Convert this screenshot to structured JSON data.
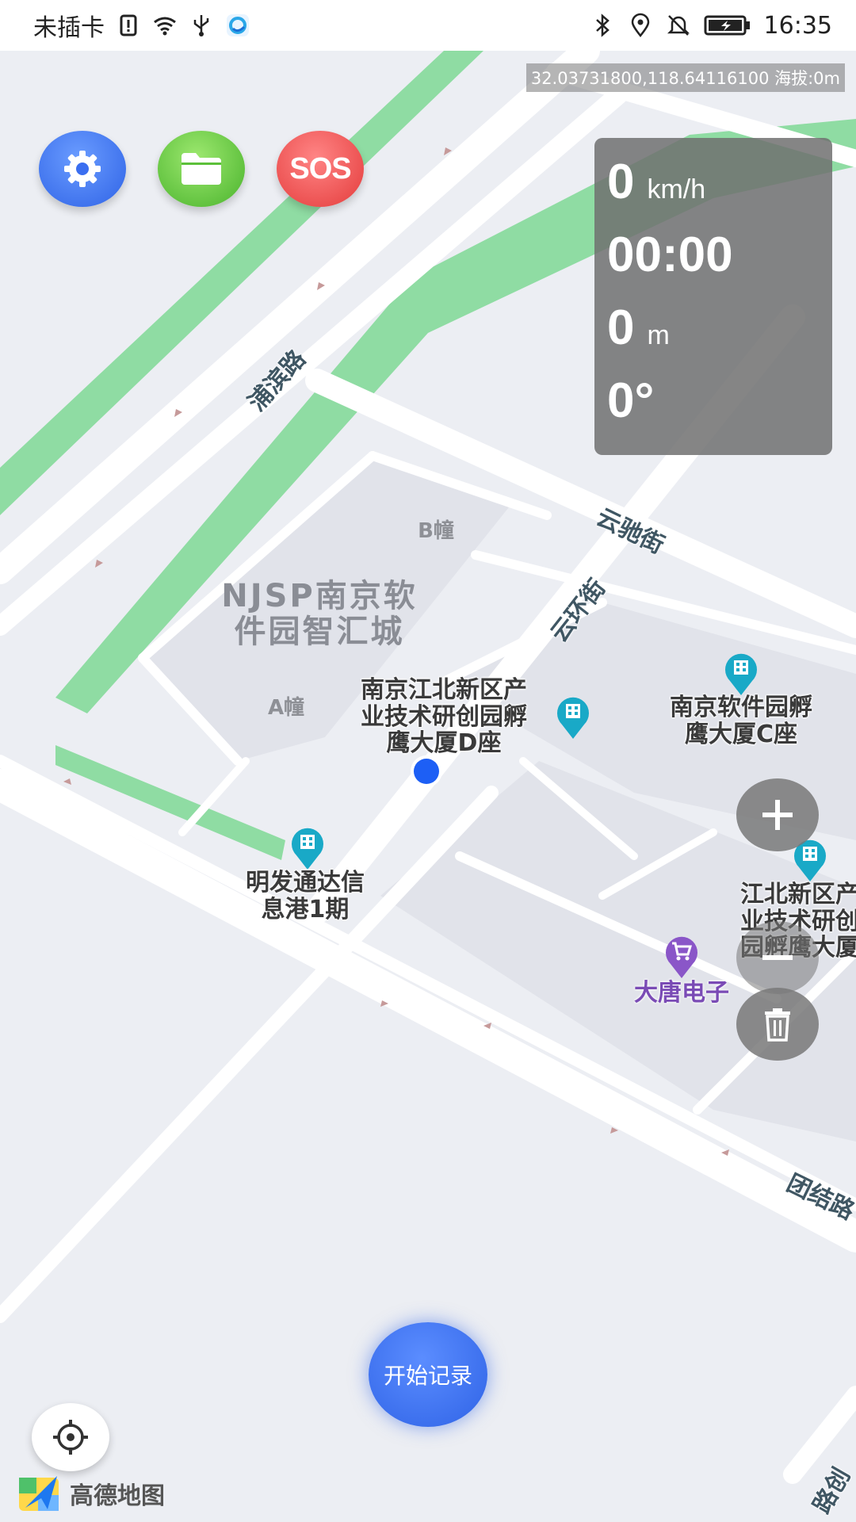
{
  "status_bar": {
    "carrier": "未插卡",
    "time": "16:35",
    "icons": [
      "sim-alert-icon",
      "wifi-icon",
      "usb-icon",
      "app-notification-icon",
      "bluetooth-icon",
      "location-icon",
      "mute-icon",
      "battery-icon"
    ]
  },
  "map": {
    "coordinate_readout": "32.03731800,118.64116100 海拔:0m",
    "area_label": "NJSP南京软\n件园智汇城",
    "buildings": {
      "a": "A幢",
      "b": "B幢"
    },
    "roads": {
      "pubin": "浦滨路",
      "yunchi": "云驰街",
      "yunhuan": "云环街",
      "tuanjie": "团结路",
      "bottom_right": "路创"
    },
    "pois": {
      "d_building": "南京江北新区产\n业技术研创园孵\n鹰大厦D座",
      "c_building": "南京软件园孵\n鹰大厦C座",
      "mingfa": "明发通达信\n息港1期",
      "jiangbei_partial": "江北新区产\n业技术研创\n园孵鹰大厦",
      "datang": "大唐电子"
    }
  },
  "toolbar": {
    "settings_icon": "gear-icon",
    "folder_icon": "folder-icon",
    "sos_label": "SOS"
  },
  "stats": {
    "speed": "0",
    "speed_unit": "km/h",
    "elapsed": "00:00",
    "distance": "0",
    "distance_unit": "m",
    "heading": "0°"
  },
  "controls": {
    "zoom_in_icon": "plus-icon",
    "zoom_out_icon": "minus-icon",
    "delete_icon": "trash-icon",
    "locate_icon": "crosshair-icon",
    "start_record_label": "开始记录"
  },
  "branding": {
    "amap_text": "高德地图"
  },
  "colors": {
    "accent_blue": "#2f63e6",
    "green_belt": "#8fdca3",
    "sos_red": "#e43b3b",
    "folder_green": "#49b32c",
    "poi_teal": "#19a9c7",
    "shop_purple": "#8a56c8"
  }
}
